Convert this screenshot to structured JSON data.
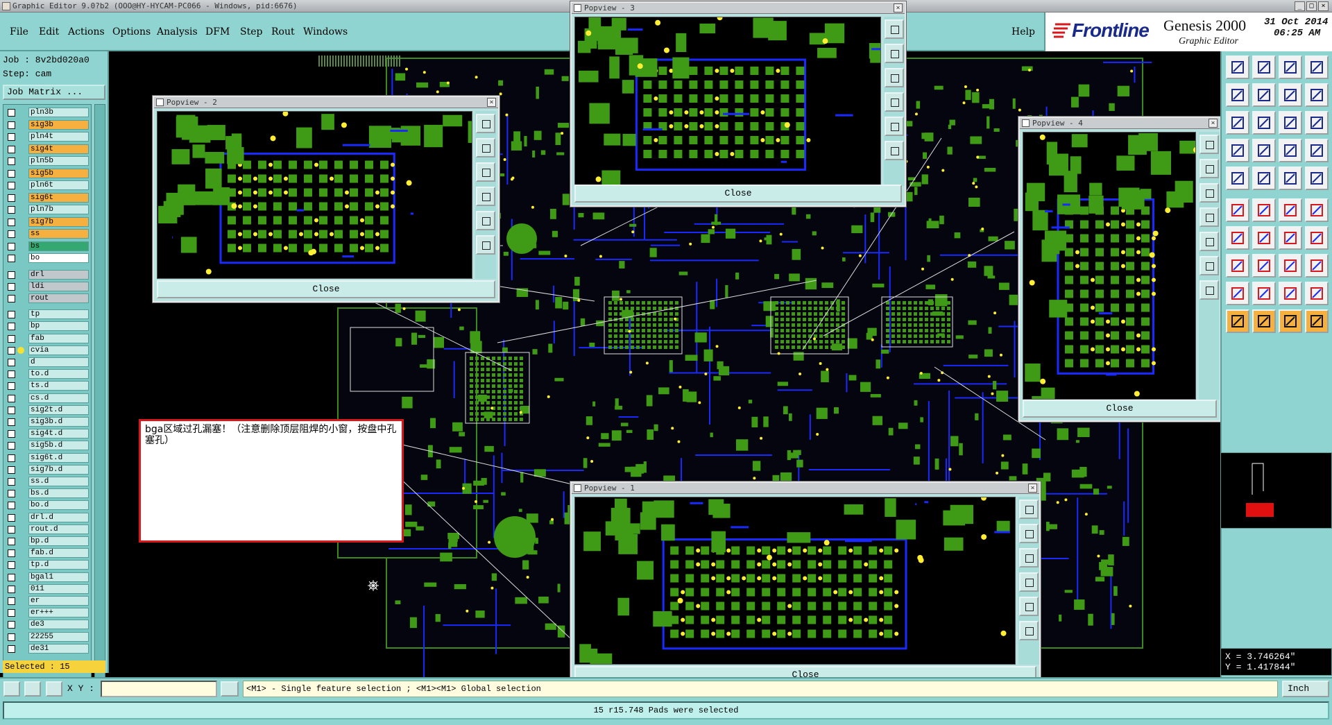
{
  "window": {
    "title": "Graphic Editor 9.0?b2 (OOO@HY-HYCAM-PC066 - Windows, pid:6676)"
  },
  "menu": {
    "items": [
      "File",
      "Edit",
      "Actions",
      "Options",
      "Analysis",
      "DFM",
      "Step",
      "Rout",
      "Windows"
    ],
    "help": "Help"
  },
  "brand": {
    "company": "Frontline",
    "product": "Genesis 2000",
    "subtitle": "Graphic Editor",
    "date": "31 Oct 2014",
    "time": "06:25 AM"
  },
  "job": {
    "job_line": "Job : 8v2bd020a0",
    "step_line": "Step: cam",
    "matrix_button": "Job Matrix ..."
  },
  "layers": [
    {
      "name": "pln3b",
      "type": "pl"
    },
    {
      "name": "sig3b",
      "type": "sig"
    },
    {
      "name": "pln4t",
      "type": "pl"
    },
    {
      "name": "sig4t",
      "type": "sig"
    },
    {
      "name": "pln5b",
      "type": "pl"
    },
    {
      "name": "sig5b",
      "type": "sig"
    },
    {
      "name": "pln6t",
      "type": "pl"
    },
    {
      "name": "sig6t",
      "type": "sig"
    },
    {
      "name": "pln7b",
      "type": "pl"
    },
    {
      "name": "sig7b",
      "type": "sig"
    },
    {
      "name": "ss",
      "type": "sig"
    },
    {
      "name": "bs",
      "type": "bs"
    },
    {
      "name": "bo",
      "type": "bo"
    },
    {
      "name": "drl",
      "type": "dr"
    },
    {
      "name": "ldi",
      "type": "dr"
    },
    {
      "name": "rout",
      "type": "dr"
    },
    {
      "name": "tp",
      "type": "pl"
    },
    {
      "name": "bp",
      "type": "pl"
    },
    {
      "name": "fab",
      "type": "pl"
    },
    {
      "name": "cvia",
      "type": "pl"
    },
    {
      "name": "d",
      "type": "pl"
    },
    {
      "name": "to.d",
      "type": "pl"
    },
    {
      "name": "ts.d",
      "type": "pl"
    },
    {
      "name": "cs.d",
      "type": "pl"
    },
    {
      "name": "sig2t.d",
      "type": "pl"
    },
    {
      "name": "sig3b.d",
      "type": "pl"
    },
    {
      "name": "sig4t.d",
      "type": "pl"
    },
    {
      "name": "sig5b.d",
      "type": "pl"
    },
    {
      "name": "sig6t.d",
      "type": "pl"
    },
    {
      "name": "sig7b.d",
      "type": "pl"
    },
    {
      "name": "ss.d",
      "type": "pl"
    },
    {
      "name": "bs.d",
      "type": "pl"
    },
    {
      "name": "bo.d",
      "type": "pl"
    },
    {
      "name": "drl.d",
      "type": "pl"
    },
    {
      "name": "rout.d",
      "type": "pl"
    },
    {
      "name": "bp.d",
      "type": "pl"
    },
    {
      "name": "fab.d",
      "type": "pl"
    },
    {
      "name": "tp.d",
      "type": "pl"
    },
    {
      "name": "bgal1",
      "type": "pl"
    },
    {
      "name": "011",
      "type": "pl"
    },
    {
      "name": "er",
      "type": "pl"
    },
    {
      "name": "er+++",
      "type": "pl"
    },
    {
      "name": "de3",
      "type": "pl"
    },
    {
      "name": "22255",
      "type": "pl"
    },
    {
      "name": "de31",
      "type": "pl"
    }
  ],
  "selected_count": "Selected : 15",
  "popviews": [
    {
      "title": "Popview - 2",
      "close": "Close"
    },
    {
      "title": "Popview - 3",
      "close": "Close"
    },
    {
      "title": "Popview - 4",
      "close": "Close"
    },
    {
      "title": "Popview - 1",
      "close": "Close"
    }
  ],
  "note": {
    "text": "bga区域过孔漏塞！（注意删除顶层阻焊的小窗，按盘中孔塞孔）"
  },
  "coords": {
    "x": "X = 3.746264\"",
    "y": "Y = 1.417844\""
  },
  "command": {
    "xy_label": "X Y :",
    "hint": "<M1> - Single feature selection ; <M1><M1> Global selection",
    "unit": "Inch"
  },
  "status": {
    "message": "15 r15.748 Pads were selected"
  },
  "colors": {
    "panel": "#8fd4d0",
    "signal_layer": "#f6b040",
    "copper_pad": "#3f9a15",
    "trace": "#1a2aff",
    "drill": "#ffee33"
  }
}
